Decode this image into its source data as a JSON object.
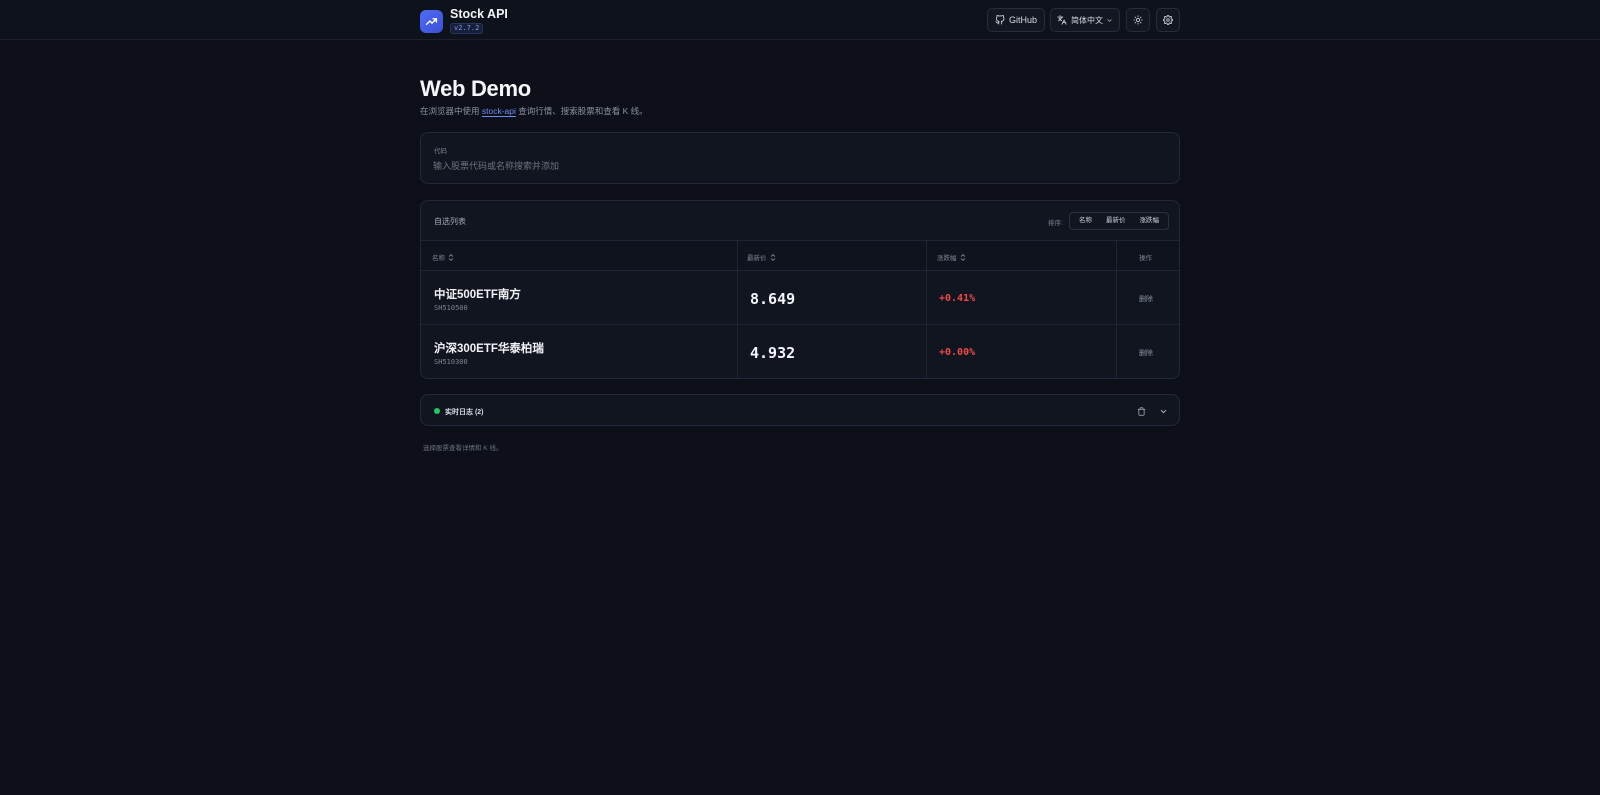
{
  "header": {
    "app_title": "Stock API",
    "version": "v2.7.2",
    "github_label": "GitHub",
    "language_label": "简体中文",
    "logo_icon": "trending-up-icon",
    "theme_icon": "sun-icon",
    "settings_icon": "gear-icon",
    "brand_color": "#4f6cf5"
  },
  "main": {
    "title": "Web Demo",
    "subtitle_prefix": "在浏览器中使用",
    "subtitle_link": "stock-api",
    "subtitle_suffix": "查询行情、搜索股票和查看 K 线。"
  },
  "search": {
    "label": "代码",
    "placeholder": "输入股票代码或名称搜索并添加"
  },
  "watchlist": {
    "title": "自选列表",
    "sort_label": "排序:",
    "sort_options": [
      "名称",
      "最新价",
      "涨跌幅"
    ],
    "columns": {
      "name": "名称",
      "price": "最新价",
      "change": "涨跌幅",
      "action": "操作"
    },
    "rows": [
      {
        "name": "中证500ETF南方",
        "code": "SH510500",
        "price": "8.649",
        "change": "+0.41%",
        "action": "删除"
      },
      {
        "name": "沪深300ETF华泰柏瑞",
        "code": "SH510300",
        "price": "4.932",
        "change": "+0.00%",
        "action": "删除"
      }
    ],
    "up_color": "#ef4a4a"
  },
  "log": {
    "title": "实时日志 (2)",
    "status_color": "#22c55e"
  },
  "footer_hint": "选择股票查看详情和 K 线。"
}
